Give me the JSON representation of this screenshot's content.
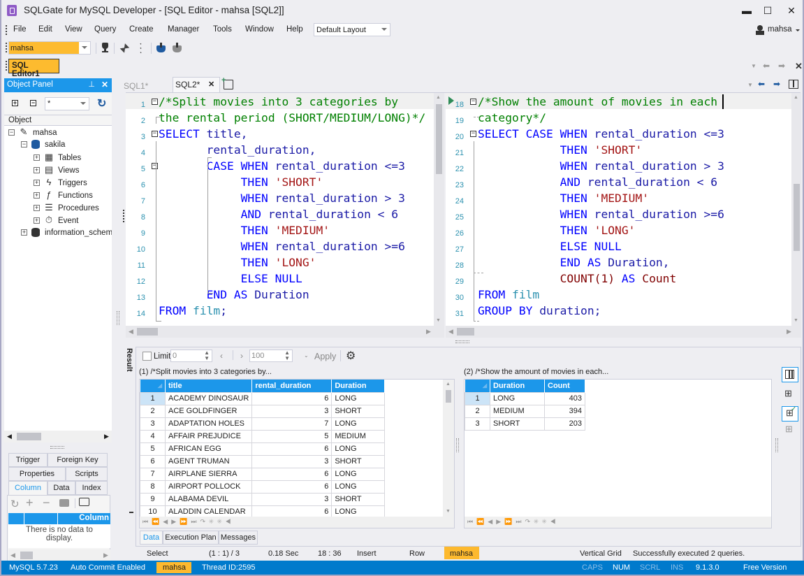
{
  "window": {
    "title": "SQLGate for MySQL Developer - [SQL Editor - mahsa [SQL2]]",
    "controls": {
      "minimize": "▬",
      "maximize": "☐",
      "close": "✕"
    }
  },
  "menu": {
    "items": [
      "File",
      "Edit",
      "View",
      "Query",
      "Create",
      "Manager",
      "Tools",
      "Window",
      "Help"
    ],
    "layout_select": "Default Layout",
    "user": "mahsa"
  },
  "toolbar": {
    "connection": "mahsa",
    "icons": [
      "database-disconnect-icon",
      "connect-icon",
      "disconnect-icon",
      "import-icon",
      "export-icon"
    ]
  },
  "doc_tab": {
    "label": "SQL Editor1"
  },
  "object_panel": {
    "title": "Object Panel",
    "filter": "*",
    "column_header": "Object",
    "tree": [
      {
        "label": "mahsa",
        "level": 0,
        "expander": "−",
        "icon": "connection-icon"
      },
      {
        "label": "sakila",
        "level": 1,
        "expander": "−",
        "icon": "database-icon"
      },
      {
        "label": "Tables",
        "level": 2,
        "expander": "+",
        "icon": "table-icon"
      },
      {
        "label": "Views",
        "level": 2,
        "expander": "+",
        "icon": "view-icon"
      },
      {
        "label": "Triggers",
        "level": 2,
        "expander": "+",
        "icon": "trigger-icon"
      },
      {
        "label": "Functions",
        "level": 2,
        "expander": "+",
        "icon": "function-icon"
      },
      {
        "label": "Procedures",
        "level": 2,
        "expander": "+",
        "icon": "procedure-icon"
      },
      {
        "label": "Event",
        "level": 2,
        "expander": "+",
        "icon": "event-icon"
      },
      {
        "label": "information_schema",
        "level": 1,
        "expander": "+",
        "icon": "database-icon"
      }
    ],
    "detail_tabs_row1": [
      "Trigger",
      "Foreign Key"
    ],
    "detail_tabs_row2": [
      "Properties",
      "Scripts"
    ],
    "detail_tabs_row3": [
      "Column",
      "Data",
      "Index"
    ],
    "active_detail_tab": "Column",
    "detail_grid_header": "Column",
    "empty_message": "There is no data to display."
  },
  "editor": {
    "tabs": [
      {
        "label": "SQL1*",
        "active": false
      },
      {
        "label": "SQL2*",
        "active": true
      }
    ],
    "left_pane": [
      {
        "n": "1",
        "tokens": [
          [
            "cm",
            "/*Split movies into 3 categories by"
          ]
        ]
      },
      {
        "n": "2",
        "tokens": [
          [
            "cm",
            "the rental period (SHORT/MEDIUM/LONG)*/"
          ]
        ]
      },
      {
        "n": "3",
        "tokens": [
          [
            "kw",
            "SELECT"
          ],
          [
            "id",
            " title,"
          ]
        ]
      },
      {
        "n": "4",
        "tokens": [
          [
            "id",
            "       rental_duration,"
          ]
        ]
      },
      {
        "n": "5",
        "tokens": [
          [
            "kw",
            "       CASE WHEN"
          ],
          [
            "id",
            " rental_duration <=3"
          ]
        ]
      },
      {
        "n": "6",
        "tokens": [
          [
            "kw",
            "            THEN"
          ],
          [
            "st",
            " 'SHORT'"
          ]
        ]
      },
      {
        "n": "7",
        "tokens": [
          [
            "kw",
            "            WHEN"
          ],
          [
            "id",
            " rental_duration > 3"
          ]
        ]
      },
      {
        "n": "8",
        "tokens": [
          [
            "kw",
            "            AND"
          ],
          [
            "id",
            " rental_duration < 6"
          ]
        ]
      },
      {
        "n": "9",
        "tokens": [
          [
            "kw",
            "            THEN"
          ],
          [
            "st",
            " 'MEDIUM'"
          ]
        ]
      },
      {
        "n": "10",
        "tokens": [
          [
            "kw",
            "            WHEN"
          ],
          [
            "id",
            " rental_duration >=6"
          ]
        ]
      },
      {
        "n": "11",
        "tokens": [
          [
            "kw",
            "            THEN"
          ],
          [
            "st",
            " 'LONG'"
          ]
        ]
      },
      {
        "n": "12",
        "tokens": [
          [
            "kw",
            "            ELSE NULL"
          ]
        ]
      },
      {
        "n": "13",
        "tokens": [
          [
            "kw",
            "       END AS"
          ],
          [
            "id",
            " Duration"
          ]
        ]
      },
      {
        "n": "14",
        "tokens": [
          [
            "kw",
            "FROM"
          ],
          [
            "tb",
            " film"
          ],
          [
            "id",
            ";"
          ]
        ]
      }
    ],
    "right_pane": [
      {
        "n": "18",
        "tokens": [
          [
            "cm",
            "/*Show the amount of movies in each"
          ]
        ]
      },
      {
        "n": "19",
        "tokens": [
          [
            "cm",
            "category*/"
          ]
        ]
      },
      {
        "n": "20",
        "tokens": [
          [
            "kw",
            "SELECT CASE WHEN"
          ],
          [
            "id",
            " rental_duration <=3"
          ]
        ]
      },
      {
        "n": "21",
        "tokens": [
          [
            "kw",
            "            THEN"
          ],
          [
            "st",
            " 'SHORT'"
          ]
        ]
      },
      {
        "n": "22",
        "tokens": [
          [
            "kw",
            "            WHEN"
          ],
          [
            "id",
            " rental_duration > 3"
          ]
        ]
      },
      {
        "n": "23",
        "tokens": [
          [
            "kw",
            "            AND"
          ],
          [
            "id",
            " rental_duration < 6"
          ]
        ]
      },
      {
        "n": "24",
        "tokens": [
          [
            "kw",
            "            THEN"
          ],
          [
            "st",
            " 'MEDIUM'"
          ]
        ]
      },
      {
        "n": "25",
        "tokens": [
          [
            "kw",
            "            WHEN"
          ],
          [
            "id",
            " rental_duration >=6"
          ]
        ]
      },
      {
        "n": "26",
        "tokens": [
          [
            "kw",
            "            THEN"
          ],
          [
            "st",
            " 'LONG'"
          ]
        ]
      },
      {
        "n": "27",
        "tokens": [
          [
            "kw",
            "            ELSE NULL"
          ]
        ]
      },
      {
        "n": "28",
        "tokens": [
          [
            "kw",
            "            END AS"
          ],
          [
            "id",
            " Duration,"
          ]
        ]
      },
      {
        "n": "29",
        "tokens": [
          [
            "fn",
            "            COUNT(1)"
          ],
          [
            "kw",
            " AS"
          ],
          [
            "fn",
            " Count"
          ]
        ]
      },
      {
        "n": "30",
        "tokens": [
          [
            "kw",
            "FROM"
          ],
          [
            "tb",
            " film"
          ]
        ]
      },
      {
        "n": "31",
        "tokens": [
          [
            "kw",
            "GROUP BY"
          ],
          [
            "id",
            " duration;"
          ]
        ]
      }
    ]
  },
  "result": {
    "side_label": "Result",
    "limit_label": "Limit",
    "limit_from": "0",
    "limit_count": "100",
    "apply_label": "Apply",
    "grid1": {
      "caption": "(1) /*Split movies into 3 categories by...",
      "columns": [
        "title",
        "rental_duration",
        "Duration"
      ],
      "rows": [
        [
          "1",
          "ACADEMY DINOSAUR",
          "6",
          "LONG"
        ],
        [
          "2",
          "ACE GOLDFINGER",
          "3",
          "SHORT"
        ],
        [
          "3",
          "ADAPTATION HOLES",
          "7",
          "LONG"
        ],
        [
          "4",
          "AFFAIR PREJUDICE",
          "5",
          "MEDIUM"
        ],
        [
          "5",
          "AFRICAN EGG",
          "6",
          "LONG"
        ],
        [
          "6",
          "AGENT TRUMAN",
          "3",
          "SHORT"
        ],
        [
          "7",
          "AIRPLANE SIERRA",
          "6",
          "LONG"
        ],
        [
          "8",
          "AIRPORT POLLOCK",
          "6",
          "LONG"
        ],
        [
          "9",
          "ALABAMA DEVIL",
          "3",
          "SHORT"
        ],
        [
          "10",
          "ALADDIN CALENDAR",
          "6",
          "LONG"
        ]
      ]
    },
    "grid2": {
      "caption": "(2) /*Show the amount of movies in each...",
      "columns": [
        "Duration",
        "Count"
      ],
      "rows": [
        [
          "1",
          "LONG",
          "403"
        ],
        [
          "2",
          "MEDIUM",
          "394"
        ],
        [
          "3",
          "SHORT",
          "203"
        ]
      ]
    },
    "bottom_tabs": [
      "Data",
      "Execution Plan",
      "Messages"
    ],
    "active_bottom_tab": "Data"
  },
  "status_line": {
    "mode": "Select",
    "position": "(1 : 1) / 3",
    "elapsed": "0.18 Sec",
    "cursor": "18 : 36",
    "insert": "Insert",
    "row": "Row",
    "user": "mahsa",
    "view": "Vertical Grid",
    "message": "Successfully executed 2 queries."
  },
  "statusbar": {
    "server": "MySQL 5.7.23",
    "autocommit": "Auto Commit Enabled",
    "user": "mahsa",
    "thread": "Thread ID:2595",
    "caps": "CAPS",
    "num": "NUM",
    "scrl": "SCRL",
    "ins": "INS",
    "version": "9.1.3.0",
    "edition": "Free Version"
  },
  "colors": {
    "accent": "#1C97EA",
    "status_bar": "#007ACC",
    "highlight": "#FDB92E"
  }
}
